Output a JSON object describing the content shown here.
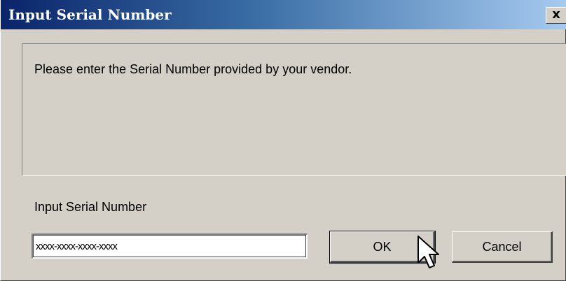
{
  "window": {
    "title": "Input Serial Number",
    "close_symbol": "x"
  },
  "message": {
    "text": "Please enter the Serial Number provided by your vendor."
  },
  "serial": {
    "label": "Input Serial Number",
    "value": "xxxx-xxxx-xxxx-xxxx"
  },
  "buttons": {
    "ok_label": "OK",
    "cancel_label": "Cancel"
  },
  "icons": {
    "close": "close-icon",
    "cursor": "mouse-pointer-icon"
  },
  "colors": {
    "titlebar_start": "#0a246a",
    "titlebar_end": "#a6caf0",
    "face": "#d4d0c8"
  }
}
